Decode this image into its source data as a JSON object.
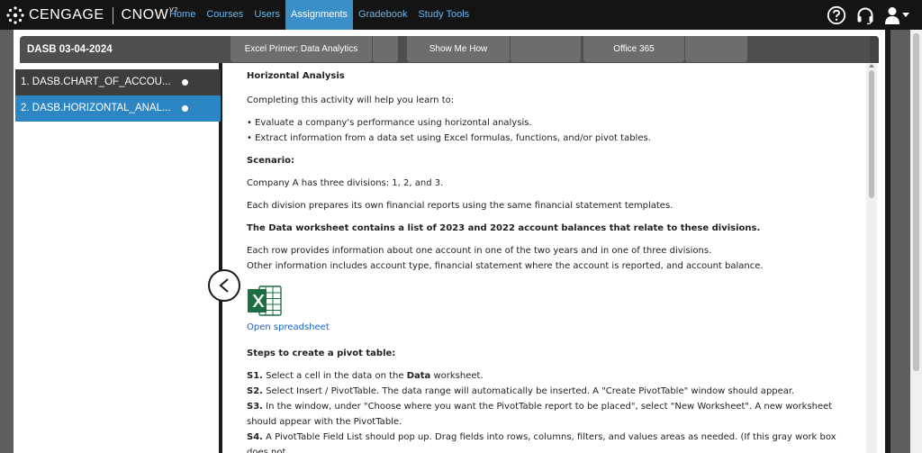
{
  "topbar": {
    "brand": "CENGAGE",
    "product": "CNOW",
    "product_version": "V2",
    "nav": [
      "Home",
      "Courses",
      "Users",
      "Assignments",
      "Gradebook",
      "Study Tools"
    ],
    "active_nav": "Assignments",
    "icons": [
      "help-icon",
      "headset-icon",
      "user-icon",
      "chevron-down-icon"
    ],
    "colors": {
      "bar": "#141414",
      "link": "#66b7f0",
      "active": "#3a8fc8"
    }
  },
  "assignment": {
    "title": "DASB 03-04-2024",
    "tabs": [
      "Excel Primer: Data Analytics",
      "Show Me How",
      "Office 365"
    ]
  },
  "sidebar": {
    "items": [
      {
        "label": "1. DASB.CHART_OF_ACCOU..."
      },
      {
        "label": "2. DASB.HORIZONTAL_ANAL..."
      }
    ],
    "collapse_icon": "chevron-left-icon"
  },
  "content": {
    "title": "Horizontal Analysis",
    "intro": "Completing this activity will help you learn to:",
    "bullets": [
      "• Evaluate a company's performance using horizontal analysis.",
      "• Extract information from a data set using Excel formulas, functions, and/or pivot tables."
    ],
    "scenario_heading": "Scenario:",
    "scenario_1": "Company A has three divisions: 1, 2, and 3.",
    "scenario_2": "Each division prepares its own financial reports using the same financial statement templates.",
    "data_heading": "The Data worksheet contains a list of 2023 and 2022 account balances that relate to these divisions.",
    "data_desc_1": "Each row provides information about one account in one of the two years and in one of three divisions.",
    "data_desc_2": "Other information includes account type, financial statement where the account is reported, and account balance.",
    "spreadsheet_icon": "excel-icon",
    "open_link": "Open spreadsheet",
    "steps_heading": "Steps to create a pivot table:",
    "steps": [
      {
        "label": "S1.",
        "pre": " Select a cell in the data on the ",
        "bold": "Data",
        "post": " worksheet."
      },
      {
        "label": "S2.",
        "text": " Select Insert / PivotTable. The data range will automatically be inserted. A \"Create PivotTable\" window should appear."
      },
      {
        "label": "S3.",
        "text": " In the window, under \"Choose where you want the PivotTable report to be placed\", select \"New Worksheet\". A new worksheet should appear with the PivotTable."
      },
      {
        "label": "S4.",
        "text": " A PivotTable Field List should pop up. Drag fields into rows, columns, filters, and values areas as needed. (If this gray work box does not"
      }
    ]
  }
}
